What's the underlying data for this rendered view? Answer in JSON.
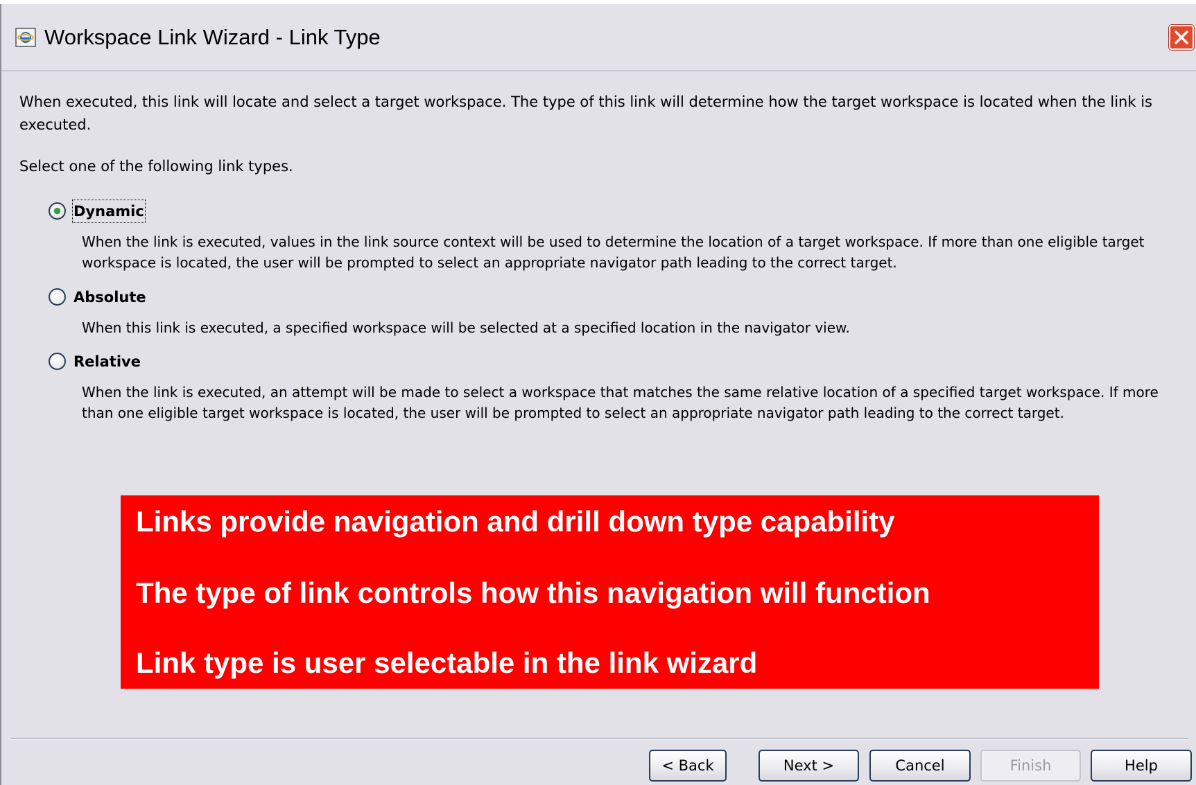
{
  "window": {
    "title": "Workspace Link Wizard - Link Type",
    "close_label": "Close"
  },
  "intro": {
    "text": "When executed, this link will locate and select a target workspace. The type of this link will determine how the target workspace is located when the link is executed.",
    "prompt": "Select one of the following link types."
  },
  "link_types": [
    {
      "label": "Dynamic",
      "selected": true,
      "description": "When the link is executed, values in the link source context will be used to determine the location of a target workspace. If more than one eligible target workspace is located, the user will be prompted to select an appropriate navigator path leading to the correct target."
    },
    {
      "label": "Absolute",
      "selected": false,
      "description": "When this link is executed, a specified workspace will be selected at a specified location in the navigator view."
    },
    {
      "label": "Relative",
      "selected": false,
      "description": "When the link is executed, an attempt will be made to select a workspace that matches the same relative location of a specified target workspace. If more than one eligible target workspace is located, the user will be prompted to select an appropriate navigator path leading to the correct target."
    }
  ],
  "callout": {
    "lines": [
      "Links provide navigation and drill down type capability",
      "The type of link controls how this navigation will function",
      "Link type is user selectable in the link wizard"
    ],
    "color": "#ff0000"
  },
  "buttons": {
    "back": "< Back",
    "next": "Next >",
    "cancel": "Cancel",
    "finish": "Finish",
    "help": "Help"
  },
  "colors": {
    "window_bg": "#e2e1e8",
    "radio_selected_dot": "#2fa23a",
    "close_button": "#e04a2c"
  }
}
